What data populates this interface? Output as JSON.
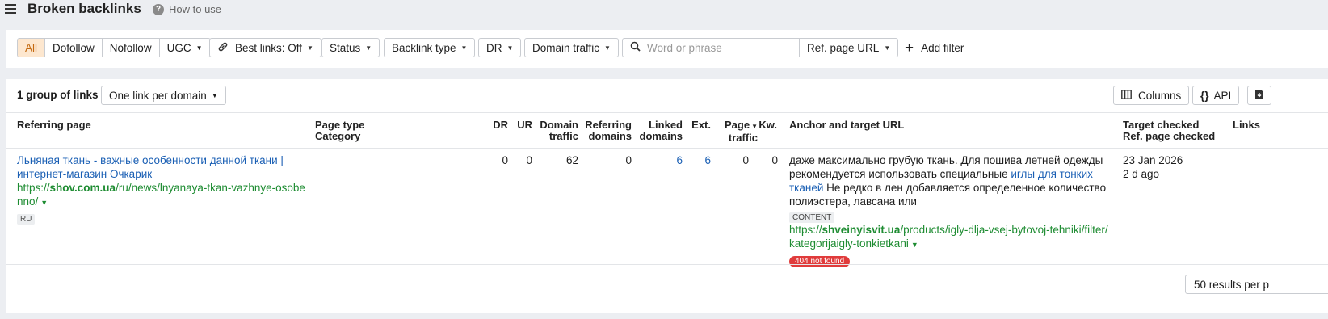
{
  "header": {
    "title": "Broken backlinks",
    "how_to_use": "How to use"
  },
  "filters": {
    "link_types": [
      "All",
      "Dofollow",
      "Nofollow",
      "UGC"
    ],
    "best_links": "Best links: Off",
    "status": "Status",
    "backlink_type": "Backlink type",
    "dr": "DR",
    "domain_traffic": "Domain traffic",
    "search_placeholder": "Word or phrase",
    "search_scope": "Ref. page URL",
    "add_filter": "Add filter"
  },
  "results": {
    "group_count": "1 group of links",
    "grouping": "One link per domain",
    "columns_button": "Columns",
    "api_button": "API"
  },
  "table": {
    "headers": {
      "referring_page": "Referring page",
      "page_type": "Page type",
      "category": "Category",
      "dr": "DR",
      "ur": "UR",
      "domain_traffic_1": "Domain",
      "domain_traffic_2": "traffic",
      "referring_domains_1": "Referring",
      "referring_domains_2": "domains",
      "linked_domains_1": "Linked",
      "linked_domains_2": "domains",
      "ext": "Ext.",
      "page_traffic_1": "Page",
      "page_traffic_2": "traffic",
      "kw": "Kw.",
      "anchor": "Anchor and target URL",
      "target_checked": "Target checked",
      "ref_page_checked": "Ref. page checked",
      "links": "Links"
    },
    "row": {
      "title_line1": "Льняная ткань - важные особенности данной ткани |",
      "title_line2": "интернет-магазин Очкарик",
      "url_prefix": "https://",
      "url_domain": "shov.com.ua",
      "url_path_line1": "/ru/news/lnyanaya-tkan-vazhnye-osobe",
      "url_path_line2": "nno/",
      "lang": "RU",
      "dr": "0",
      "ur": "0",
      "domain_traffic": "62",
      "referring_domains": "0",
      "linked_domains": "6",
      "ext": "6",
      "page_traffic": "0",
      "kw": "0",
      "anchor_text_line1": "даже максимально грубую ткань. Для пошива летней одежды",
      "anchor_text_line2_a": "рекомендуется использовать специальные ",
      "anchor_link_a": "иглы для тонких",
      "anchor_link_b": "тканей",
      "anchor_text_line3_b": " Не редко в лен добавляется определенное количество",
      "anchor_text_line4": "полиэстера, лавсана или",
      "content_badge": "CONTENT",
      "target_prefix": "https://",
      "target_domain": "shveinyisvit.ua",
      "target_path_line1": "/products/igly-dlja-vsej-bytovoj-tehniki/filter/",
      "target_path_line2": "kategorijaigly-tonkietkani",
      "status_badge": "404 not found",
      "target_checked_date": "23 Jan 2026",
      "ref_page_checked_ago": "2 d ago"
    }
  },
  "footer": {
    "per_page": "50 results per p"
  },
  "colors": {
    "accent_active_bg": "#fde7cf",
    "accent_active_text": "#c46a10",
    "link_blue": "#1a5fb4",
    "url_green": "#1e8c32",
    "error_red": "#e03b3b"
  }
}
